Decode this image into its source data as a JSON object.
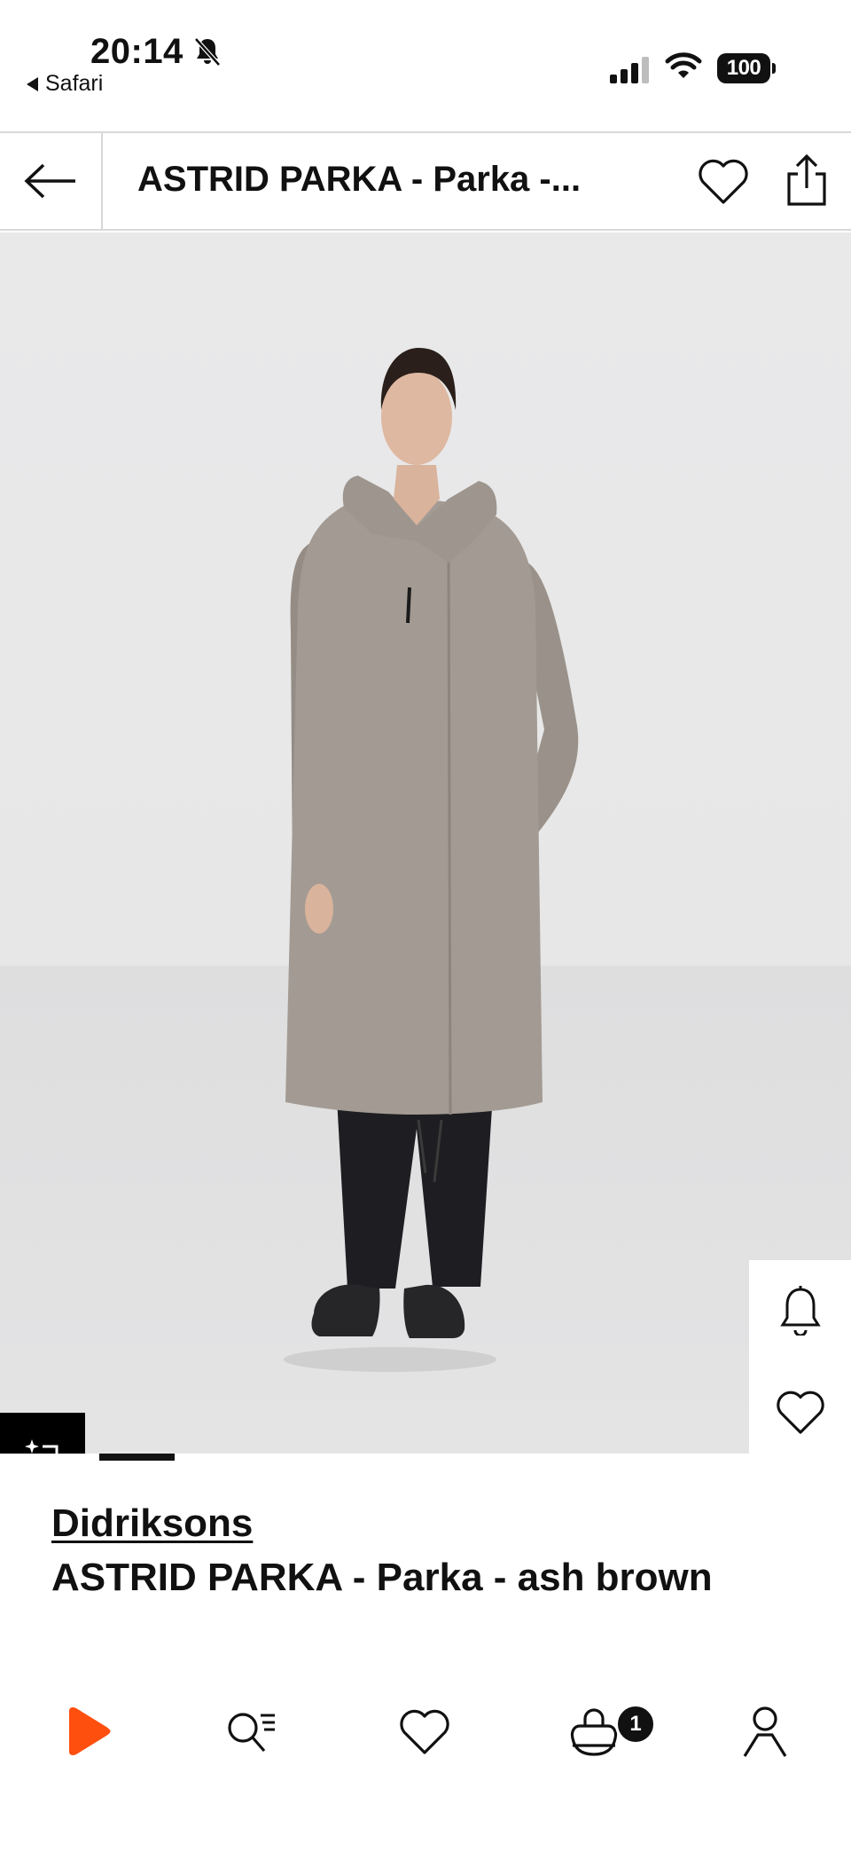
{
  "status_bar": {
    "time": "20:14",
    "back_app": "Safari",
    "battery": "100",
    "icons": [
      "bell-off-icon",
      "signal-icon",
      "wifi-icon",
      "battery-icon"
    ]
  },
  "header": {
    "title": "ASTRID PARKA - Parka -...",
    "icons": [
      "arrow-left-icon",
      "heart-icon",
      "share-icon"
    ]
  },
  "gallery": {
    "image_progress": 0.125,
    "colors": {
      "background": "#e8e8e9",
      "coat": "#a39b93",
      "trousers": "#1e1e22"
    }
  },
  "product": {
    "brand": "Didriksons",
    "name": "ASTRID PARKA - Parka - ash brown"
  },
  "bottom_nav": {
    "cart_count": "1",
    "items": [
      "home-icon",
      "search-icon",
      "wishlist-icon",
      "cart-icon",
      "account-icon"
    ],
    "accent": "#ff4f0f"
  }
}
